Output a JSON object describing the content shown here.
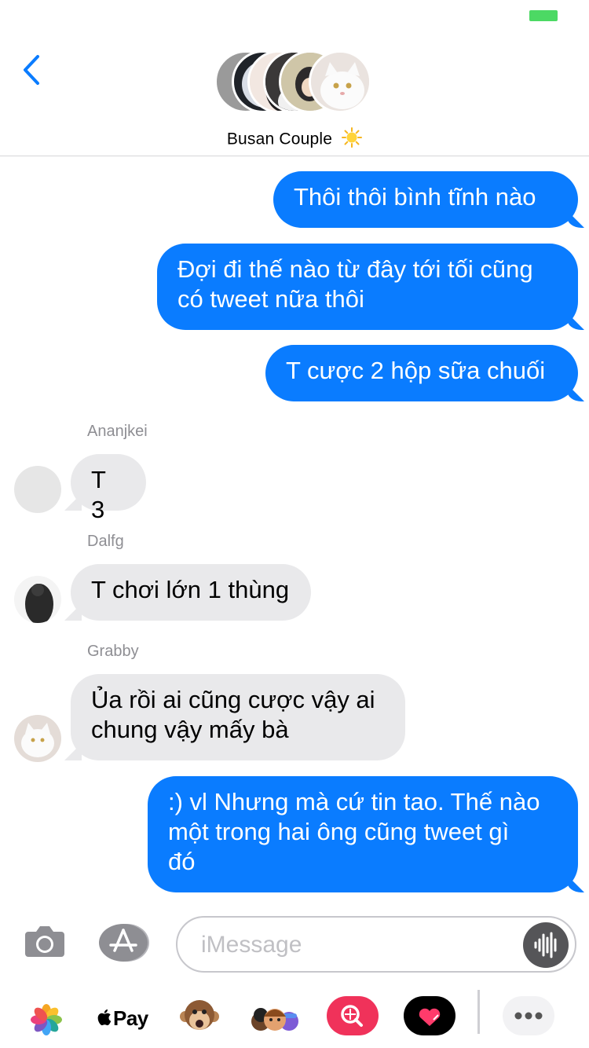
{
  "header": {
    "group_name": "Busan Couple",
    "group_emoji": "sun"
  },
  "thread": {
    "messages": [
      {
        "direction": "outgoing",
        "lines": [
          "Thôi thôi bình tĩnh nào"
        ]
      },
      {
        "direction": "outgoing",
        "lines": [
          "Đợi đi thế nào từ đây tới tối cũng",
          "có tweet nữa thôi"
        ]
      },
      {
        "direction": "outgoing",
        "lines": [
          "T cược 2 hộp sữa chuối"
        ]
      },
      {
        "direction": "incoming",
        "sender": "Ananjkei",
        "lines": [
          "T 3"
        ]
      },
      {
        "direction": "incoming",
        "sender": "Dalfg",
        "lines": [
          "T chơi lớn 1 thùng"
        ]
      },
      {
        "direction": "incoming",
        "sender": "Grabby",
        "lines": [
          "Ủa rồi ai cũng cược vậy ai",
          "chung vậy mấy bà"
        ]
      },
      {
        "direction": "outgoing",
        "lines": [
          ":) vl Nhưng mà cứ tin tao. Thế nào",
          "một trong hai ông cũng tweet gì",
          "đó"
        ]
      }
    ]
  },
  "composer": {
    "placeholder": "iMessage"
  },
  "app_drawer": {
    "applepay_label": "Pay",
    "items": [
      "photos-icon",
      "apple-pay-icon",
      "animoji-icon",
      "memoji-icon",
      "search-images-icon",
      "digital-touch-icon",
      "more-icon"
    ]
  },
  "colors": {
    "outgoing_bubble": "#0a7cff",
    "incoming_bubble": "#e9e9eb",
    "accent": "#0a7cff",
    "battery": "#4cd964"
  }
}
